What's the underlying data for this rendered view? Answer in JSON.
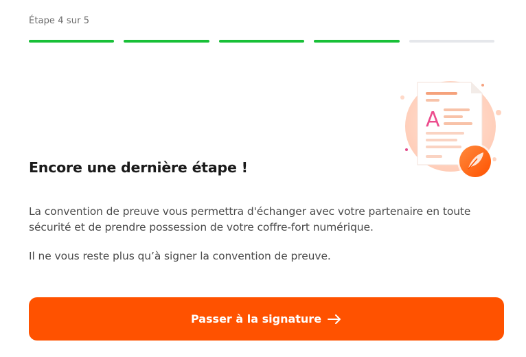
{
  "stepper": {
    "label": "Étape 4 sur 5",
    "current": 4,
    "total": 5,
    "segments": [
      {
        "state": "done"
      },
      {
        "state": "done"
      },
      {
        "state": "done"
      },
      {
        "state": "done"
      },
      {
        "state": "pending"
      }
    ],
    "done_color": "#18c037",
    "pending_color": "#e5e7eb"
  },
  "illustration": {
    "icon": "document-signature-illustration",
    "letter": "A"
  },
  "content": {
    "title": "Encore une dernière étape !",
    "description": "La convention de preuve vous permettra d'échanger avec votre partenaire en toute sécurité et de prendre possession de votre coffre-fort numérique.",
    "hint": "Il ne vous reste plus qu’à signer la convention de preuve."
  },
  "cta": {
    "label": "Passer à la signature",
    "icon": "arrow-right-icon",
    "color": "#ff5200"
  }
}
